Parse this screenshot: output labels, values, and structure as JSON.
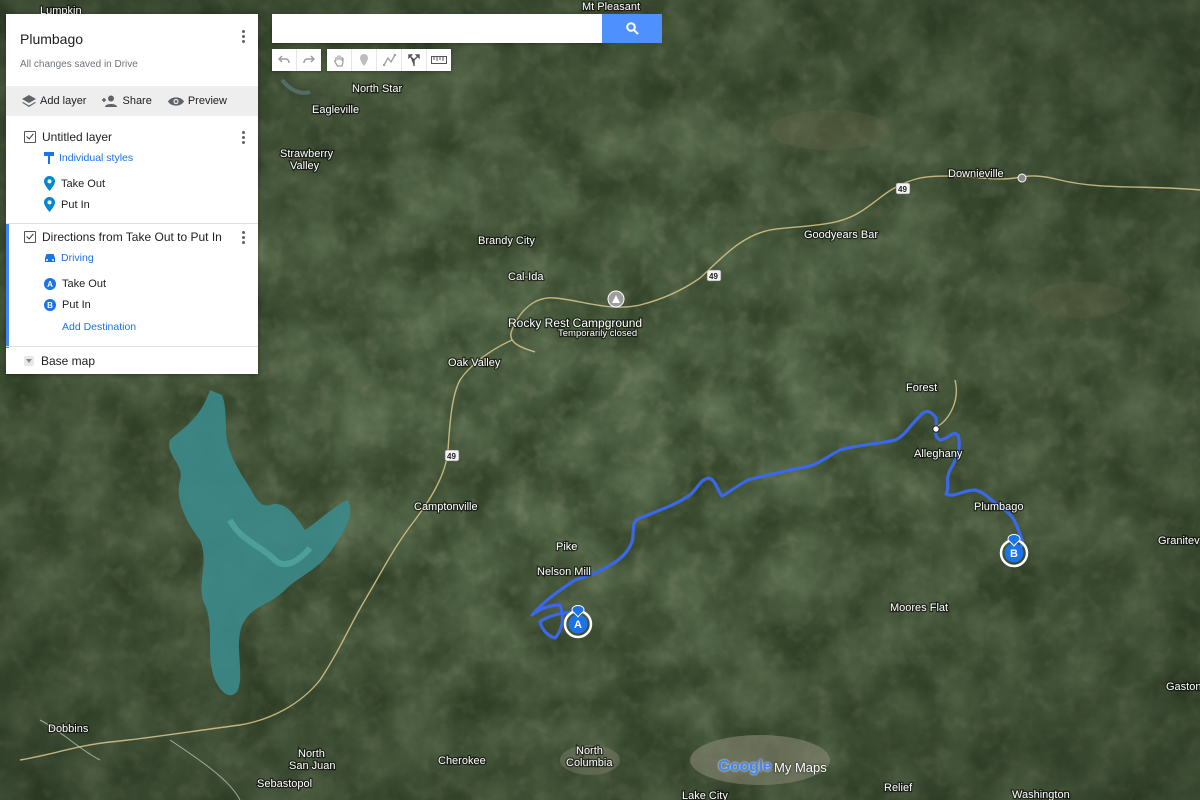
{
  "panel": {
    "title": "Plumbago",
    "subtitle": "All changes saved in Drive",
    "actions": {
      "add_layer": "Add layer",
      "share": "Share",
      "preview": "Preview"
    },
    "layer1": {
      "title": "Untitled layer",
      "style_link": "Individual styles",
      "items": [
        "Take Out",
        "Put In"
      ]
    },
    "layer2": {
      "title": "Directions from Take Out to Put In",
      "mode": "Driving",
      "stops": [
        {
          "badge": "A",
          "label": "Take Out"
        },
        {
          "badge": "B",
          "label": "Put In"
        }
      ],
      "add_destination": "Add Destination"
    },
    "base_map": "Base map"
  },
  "search": {
    "value": "",
    "placeholder": ""
  },
  "map": {
    "labels": {
      "mt_pleasant": "Mt Pleasant",
      "north_star": "North Star",
      "eagleville": "Eagleville",
      "strawberry_valley_1": "Strawberry",
      "strawberry_valley_2": "Valley",
      "downieville": "Downieville",
      "goodyears_bar": "Goodyears Bar",
      "brandy_city": "Brandy City",
      "cal_ida": "Cal-Ida",
      "rocky_rest": "Rocky Rest Campground",
      "temporarily_closed": "Temporarily closed",
      "oak_valley": "Oak Valley",
      "forest": "Forest",
      "alleghany": "Alleghany",
      "plumbago": "Plumbago",
      "camptonville": "Camptonville",
      "pike": "Pike",
      "nelson_mill": "Nelson Mill",
      "moores_flat": "Moores Flat",
      "graniteville": "Granitev",
      "gaston": "Gaston",
      "dobbins": "Dobbins",
      "north_san_juan_1": "North",
      "north_san_juan_2": "San Juan",
      "cherokee": "Cherokee",
      "north_columbia_1": "North",
      "north_columbia_2": "Columbia",
      "sebastopol": "Sebastopol",
      "relief": "Relief",
      "washington": "Washington",
      "lake_city": "Lake City",
      "lumpkin": "Lumpkin",
      "highway_49": "49"
    },
    "markers": {
      "a": "A",
      "b": "B"
    },
    "colors": {
      "route": "#3a68e8",
      "accent": "#4d90fe",
      "water": "#3b8a8a"
    },
    "attribution": {
      "google": "Google",
      "product": "My Maps"
    }
  }
}
